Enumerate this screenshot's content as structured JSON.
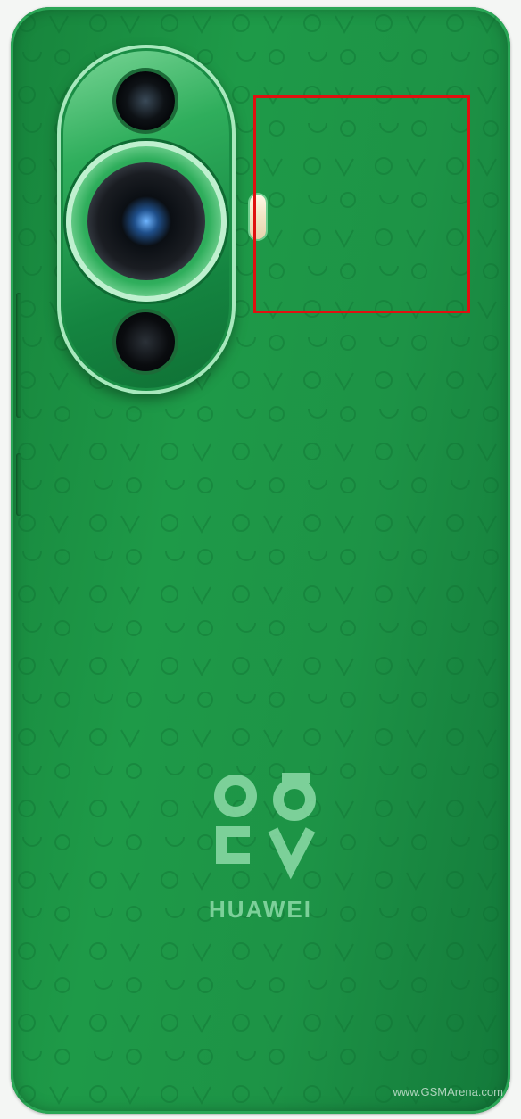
{
  "photo": {
    "subject": "green smartphone back",
    "body_color": "#1e9a48",
    "highlight_color": "#e01010"
  },
  "branding": {
    "brand_name": "HUAWEI",
    "logo_icon": "nova-logo-icon"
  },
  "watermark": {
    "text": "www.GSMArena.com"
  }
}
